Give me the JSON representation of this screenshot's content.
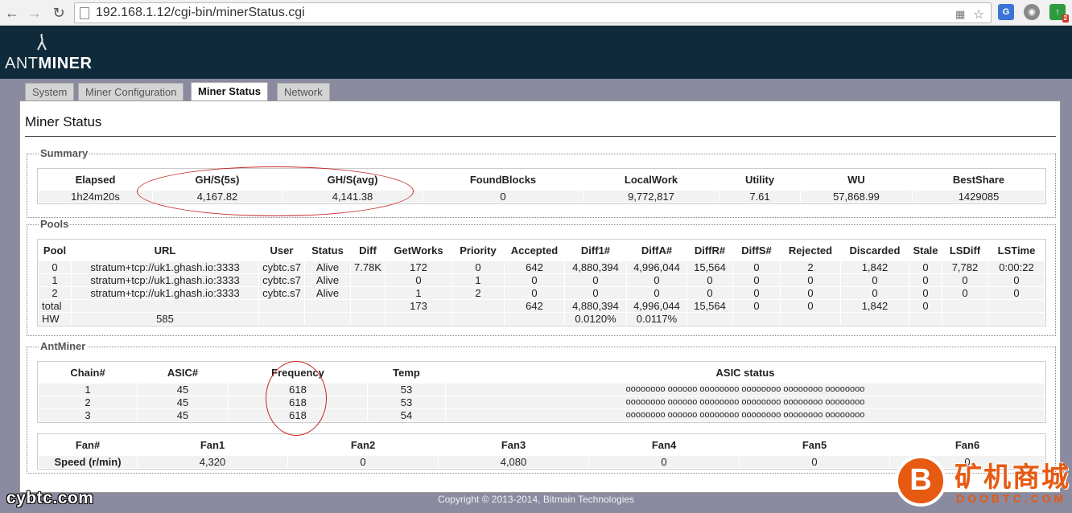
{
  "browser": {
    "url": "192.168.1.12/cgi-bin/minerStatus.cgi"
  },
  "brand": {
    "logo_prefix": "ANT",
    "logo_suffix": "MINER"
  },
  "tabs": [
    {
      "label": "System"
    },
    {
      "label": "Miner Configuration"
    },
    {
      "label": "Miner Status"
    },
    {
      "label": "Network"
    }
  ],
  "page_title": "Miner Status",
  "summary": {
    "legend": "Summary",
    "headers": [
      "Elapsed",
      "GH/S(5s)",
      "GH/S(avg)",
      "FoundBlocks",
      "LocalWork",
      "Utility",
      "WU",
      "BestShare"
    ],
    "row": [
      "1h24m20s",
      "4,167.82",
      "4,141.38",
      "0",
      "9,772,817",
      "7.61",
      "57,868.99",
      "1429085"
    ]
  },
  "pools": {
    "legend": "Pools",
    "headers": [
      "Pool",
      "URL",
      "User",
      "Status",
      "Diff",
      "GetWorks",
      "Priority",
      "Accepted",
      "Diff1#",
      "DiffA#",
      "DiffR#",
      "DiffS#",
      "Rejected",
      "Discarded",
      "Stale",
      "LSDiff",
      "LSTime"
    ],
    "rows": [
      [
        "0",
        "stratum+tcp://uk1.ghash.io:3333",
        "cybtc.s7",
        "Alive",
        "7.78K",
        "172",
        "0",
        "642",
        "4,880,394",
        "4,996,044",
        "15,564",
        "0",
        "2",
        "1,842",
        "0",
        "7,782",
        "0:00:22"
      ],
      [
        "1",
        "stratum+tcp://uk1.ghash.io:3333",
        "cybtc.s7",
        "Alive",
        "",
        "0",
        "1",
        "0",
        "0",
        "0",
        "0",
        "0",
        "0",
        "0",
        "0",
        "0",
        "0"
      ],
      [
        "2",
        "stratum+tcp://uk1.ghash.io:3333",
        "cybtc.s7",
        "Alive",
        "",
        "1",
        "2",
        "0",
        "0",
        "0",
        "0",
        "0",
        "0",
        "0",
        "0",
        "0",
        "0"
      ],
      [
        "total",
        "",
        "",
        "",
        "",
        "173",
        "",
        "642",
        "4,880,394",
        "4,996,044",
        "15,564",
        "0",
        "0",
        "1,842",
        "0",
        "",
        ""
      ],
      [
        "HW",
        "585",
        "",
        "",
        "",
        "",
        "",
        "",
        "0.0120%",
        "0.0117%",
        "",
        "",
        "",
        "",
        "",
        "",
        ""
      ]
    ]
  },
  "antminer": {
    "legend": "AntMiner",
    "headers": [
      "Chain#",
      "ASIC#",
      "Frequency",
      "Temp",
      "ASIC status"
    ],
    "rows": [
      [
        "1",
        "45",
        "618",
        "53",
        "oooooooo oooooo oooooooo oooooooo oooooooo oooooooo"
      ],
      [
        "2",
        "45",
        "618",
        "53",
        "oooooooo oooooo oooooooo oooooooo oooooooo oooooooo"
      ],
      [
        "3",
        "45",
        "618",
        "54",
        "oooooooo oooooo oooooooo oooooooo oooooooo oooooooo"
      ]
    ],
    "fan_headers": [
      "Fan#",
      "Fan1",
      "Fan2",
      "Fan3",
      "Fan4",
      "Fan5",
      "Fan6"
    ],
    "fan_row": [
      "Speed (r/min)",
      "4,320",
      "0",
      "4,080",
      "0",
      "0",
      "0"
    ]
  },
  "footer": "Copyright © 2013-2014, Bitmain Technologies",
  "watermarks": {
    "left": "cybtc.com",
    "right_cn": "矿机商城",
    "right_url": "DOOBTC.COM",
    "coin_glyph": "B"
  },
  "colors": {
    "header_bg": "#0f2a3a",
    "annotation_red": "#c62828",
    "watermark_orange": "#e65a12"
  }
}
